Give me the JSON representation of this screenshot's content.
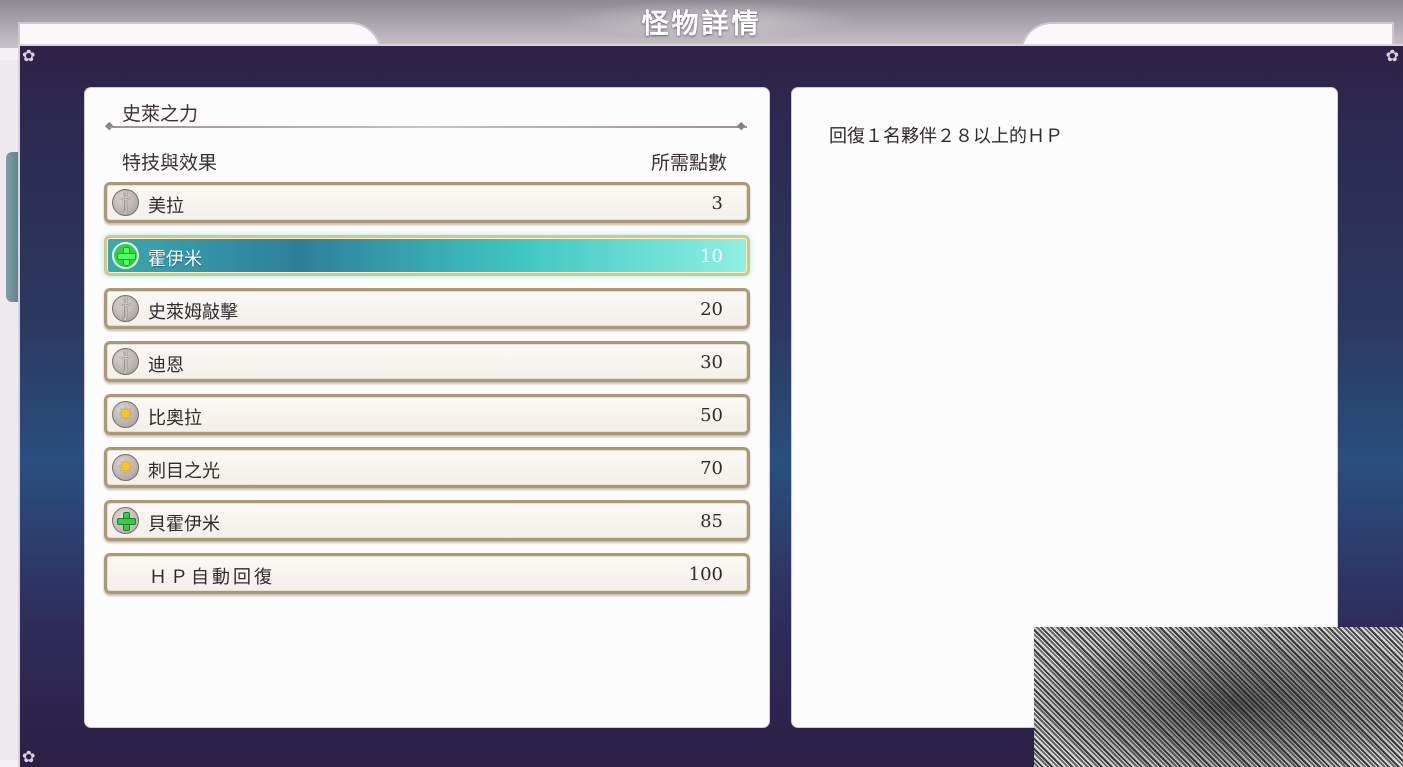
{
  "page_title": "怪物詳情",
  "monster": {
    "name": "史萊之力"
  },
  "columns": {
    "skill_effect": "特技與效果",
    "required_points": "所需點數"
  },
  "skills": [
    {
      "icon": "sword-icon",
      "label": "美拉",
      "cost": "3",
      "selected": false
    },
    {
      "icon": "heal-plus-icon",
      "label": "霍伊米",
      "cost": "10",
      "selected": true
    },
    {
      "icon": "sword-icon",
      "label": "史萊姆敲擊",
      "cost": "20",
      "selected": false
    },
    {
      "icon": "sword-icon",
      "label": "迪恩",
      "cost": "30",
      "selected": false
    },
    {
      "icon": "buff-burst-icon",
      "label": "比奧拉",
      "cost": "50",
      "selected": false
    },
    {
      "icon": "buff-burst-icon",
      "label": "刺目之光",
      "cost": "70",
      "selected": false
    },
    {
      "icon": "heal-plus-icon",
      "label": "貝霍伊米",
      "cost": "85",
      "selected": false
    },
    {
      "icon": "",
      "label": "ＨＰ自動回復",
      "cost": "100",
      "selected": false
    }
  ],
  "detail": {
    "description": "回復１名夥伴２８以上的ＨＰ"
  },
  "colors": {
    "selected_row": "#3fc7c2",
    "frame": "#2b3a63",
    "panel": "#fdfcfd"
  }
}
